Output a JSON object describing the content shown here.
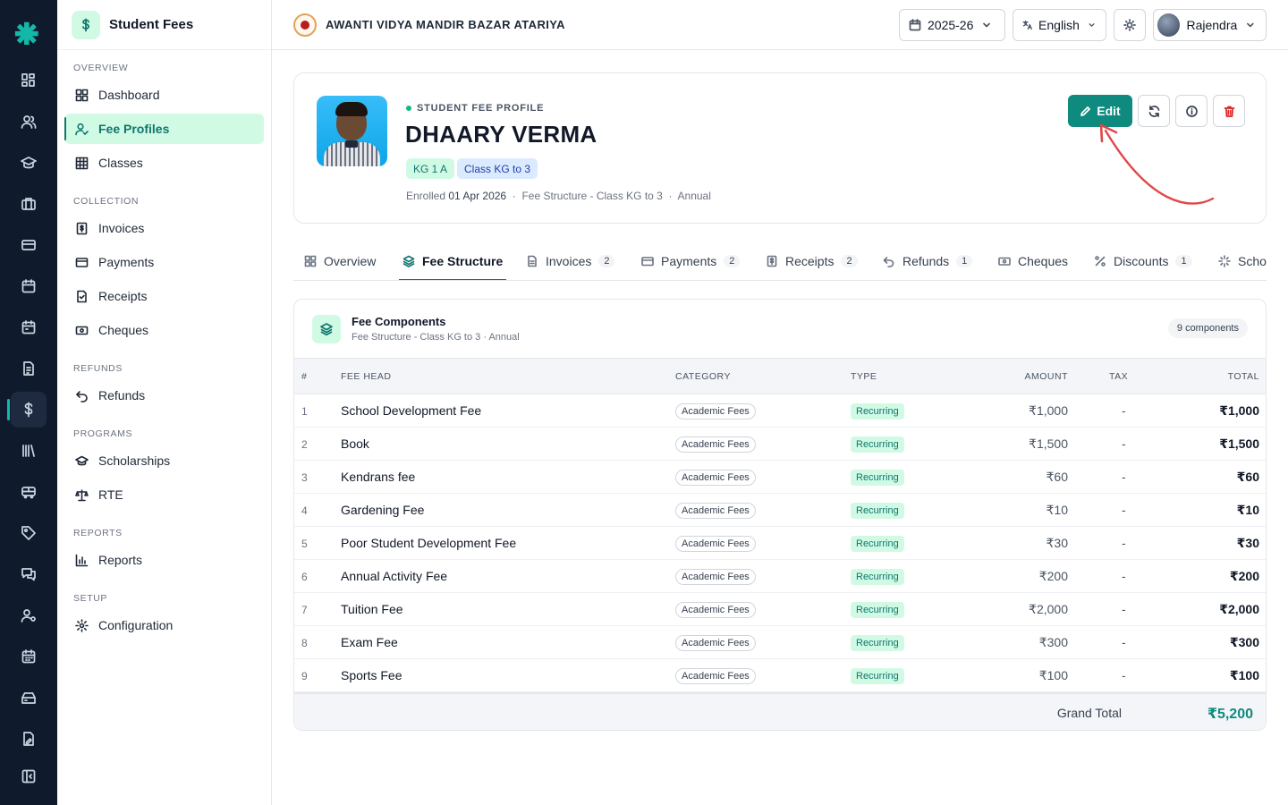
{
  "module": {
    "title": "Student Fees"
  },
  "sidebar": {
    "sections": [
      {
        "label": "OVERVIEW",
        "items": [
          {
            "label": "Dashboard",
            "icon": "dashboard-icon"
          },
          {
            "label": "Fee Profiles",
            "icon": "user-check-icon",
            "active": true
          },
          {
            "label": "Classes",
            "icon": "grid-icon"
          }
        ]
      },
      {
        "label": "COLLECTION",
        "items": [
          {
            "label": "Invoices",
            "icon": "invoice-icon"
          },
          {
            "label": "Payments",
            "icon": "card-icon"
          },
          {
            "label": "Receipts",
            "icon": "receipt-icon"
          },
          {
            "label": "Cheques",
            "icon": "cheque-icon"
          }
        ]
      },
      {
        "label": "REFUNDS",
        "items": [
          {
            "label": "Refunds",
            "icon": "undo-icon"
          }
        ]
      },
      {
        "label": "PROGRAMS",
        "items": [
          {
            "label": "Scholarships",
            "icon": "graduation-icon"
          },
          {
            "label": "RTE",
            "icon": "scale-icon"
          }
        ]
      },
      {
        "label": "REPORTS",
        "items": [
          {
            "label": "Reports",
            "icon": "bar-chart-icon"
          }
        ]
      },
      {
        "label": "SETUP",
        "items": [
          {
            "label": "Configuration",
            "icon": "gear-icon"
          }
        ]
      }
    ]
  },
  "topbar": {
    "school_name": "AWANTI VIDYA MANDIR BAZAR ATARIYA",
    "year": "2025-26",
    "language": "English",
    "user": "Rajendra"
  },
  "profile": {
    "eyebrow": "STUDENT FEE PROFILE",
    "name": "DHAARY VERMA",
    "section_chip": "KG 1 A",
    "class_chip": "Class KG to 3",
    "enrolled_label": "Enrolled",
    "enrolled_date": "01 Apr 2026",
    "structure": "Fee Structure - Class KG to 3",
    "frequency": "Annual",
    "edit_label": "Edit"
  },
  "tabs": [
    {
      "label": "Overview",
      "count": ""
    },
    {
      "label": "Fee Structure",
      "count": "",
      "active": true
    },
    {
      "label": "Invoices",
      "count": "2"
    },
    {
      "label": "Payments",
      "count": "2"
    },
    {
      "label": "Receipts",
      "count": "2"
    },
    {
      "label": "Refunds",
      "count": "1"
    },
    {
      "label": "Cheques",
      "count": ""
    },
    {
      "label": "Discounts",
      "count": "1"
    },
    {
      "label": "Scho",
      "count": ""
    }
  ],
  "fees": {
    "title": "Fee Components",
    "subtitle": "Fee Structure - Class KG to 3 · Annual",
    "components_badge": "9 components",
    "columns": {
      "idx": "#",
      "head": "FEE HEAD",
      "category": "CATEGORY",
      "type": "TYPE",
      "amount": "AMOUNT",
      "tax": "TAX",
      "total": "TOTAL"
    },
    "rows": [
      {
        "idx": "1",
        "head": "School Development Fee",
        "category": "Academic Fees",
        "type": "Recurring",
        "amount": "₹1,000",
        "tax": "-",
        "total": "₹1,000"
      },
      {
        "idx": "2",
        "head": "Book",
        "category": "Academic Fees",
        "type": "Recurring",
        "amount": "₹1,500",
        "tax": "-",
        "total": "₹1,500"
      },
      {
        "idx": "3",
        "head": "Kendrans fee",
        "category": "Academic Fees",
        "type": "Recurring",
        "amount": "₹60",
        "tax": "-",
        "total": "₹60"
      },
      {
        "idx": "4",
        "head": "Gardening Fee",
        "category": "Academic Fees",
        "type": "Recurring",
        "amount": "₹10",
        "tax": "-",
        "total": "₹10"
      },
      {
        "idx": "5",
        "head": "Poor Student Development Fee",
        "category": "Academic Fees",
        "type": "Recurring",
        "amount": "₹30",
        "tax": "-",
        "total": "₹30"
      },
      {
        "idx": "6",
        "head": "Annual Activity Fee",
        "category": "Academic Fees",
        "type": "Recurring",
        "amount": "₹200",
        "tax": "-",
        "total": "₹200"
      },
      {
        "idx": "7",
        "head": "Tuition Fee",
        "category": "Academic Fees",
        "type": "Recurring",
        "amount": "₹2,000",
        "tax": "-",
        "total": "₹2,000"
      },
      {
        "idx": "8",
        "head": "Exam Fee",
        "category": "Academic Fees",
        "type": "Recurring",
        "amount": "₹300",
        "tax": "-",
        "total": "₹300"
      },
      {
        "idx": "9",
        "head": "Sports Fee",
        "category": "Academic Fees",
        "type": "Recurring",
        "amount": "₹100",
        "tax": "-",
        "total": "₹100"
      }
    ],
    "grand_total_label": "Grand Total",
    "grand_total": "₹5,200"
  },
  "colors": {
    "accent": "#0f8a7e",
    "rail": "#0f1b2d",
    "annotation_arrow": "#e04848"
  }
}
